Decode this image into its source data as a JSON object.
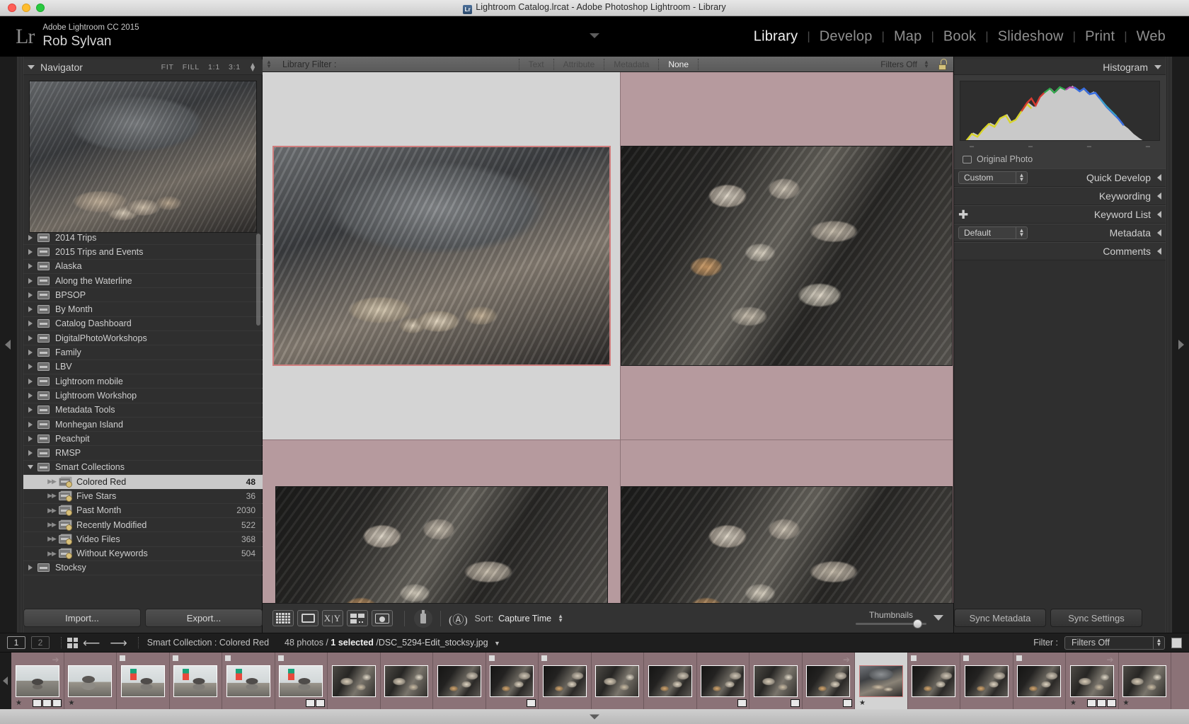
{
  "window": {
    "title": "Lightroom Catalog.lrcat - Adobe Photoshop Lightroom - Library",
    "app_icon": "lightroom-app-icon"
  },
  "identity": {
    "logo": "Lr",
    "product": "Adobe Lightroom CC 2015",
    "user": "Rob Sylvan"
  },
  "modules": [
    {
      "label": "Library",
      "active": true
    },
    {
      "label": "Develop",
      "active": false
    },
    {
      "label": "Map",
      "active": false
    },
    {
      "label": "Book",
      "active": false
    },
    {
      "label": "Slideshow",
      "active": false
    },
    {
      "label": "Print",
      "active": false
    },
    {
      "label": "Web",
      "active": false
    }
  ],
  "navigator": {
    "title": "Navigator",
    "zoom_levels": [
      "FIT",
      "FILL",
      "1:1",
      "3:1"
    ]
  },
  "collections": [
    {
      "label": "2014 Trips",
      "count": "",
      "level": 0,
      "twisty": "closed",
      "icon": "folder-icon"
    },
    {
      "label": "2015 Trips and Events",
      "count": "",
      "level": 0,
      "twisty": "closed",
      "icon": "folder-icon"
    },
    {
      "label": "Alaska",
      "count": "",
      "level": 0,
      "twisty": "closed",
      "icon": "folder-icon"
    },
    {
      "label": "Along the Waterline",
      "count": "",
      "level": 0,
      "twisty": "closed",
      "icon": "folder-icon"
    },
    {
      "label": "BPSOP",
      "count": "",
      "level": 0,
      "twisty": "closed",
      "icon": "folder-icon"
    },
    {
      "label": "By Month",
      "count": "",
      "level": 0,
      "twisty": "closed",
      "icon": "folder-icon"
    },
    {
      "label": "Catalog Dashboard",
      "count": "",
      "level": 0,
      "twisty": "closed",
      "icon": "folder-icon"
    },
    {
      "label": "DigitalPhotoWorkshops",
      "count": "",
      "level": 0,
      "twisty": "closed",
      "icon": "folder-icon"
    },
    {
      "label": "Family",
      "count": "",
      "level": 0,
      "twisty": "closed",
      "icon": "folder-icon"
    },
    {
      "label": "LBV",
      "count": "",
      "level": 0,
      "twisty": "closed",
      "icon": "folder-icon"
    },
    {
      "label": "Lightroom mobile",
      "count": "",
      "level": 0,
      "twisty": "closed",
      "icon": "folder-icon"
    },
    {
      "label": "Lightroom Workshop",
      "count": "",
      "level": 0,
      "twisty": "closed",
      "icon": "folder-icon"
    },
    {
      "label": "Metadata Tools",
      "count": "",
      "level": 0,
      "twisty": "closed",
      "icon": "folder-icon"
    },
    {
      "label": "Monhegan Island",
      "count": "",
      "level": 0,
      "twisty": "closed",
      "icon": "folder-icon"
    },
    {
      "label": "Peachpit",
      "count": "",
      "level": 0,
      "twisty": "closed",
      "icon": "folder-icon"
    },
    {
      "label": "RMSP",
      "count": "",
      "level": 0,
      "twisty": "closed",
      "icon": "folder-icon"
    },
    {
      "label": "Smart Collections",
      "count": "",
      "level": 0,
      "twisty": "open",
      "icon": "folder-icon"
    },
    {
      "label": "Colored Red",
      "count": "48",
      "level": 1,
      "twisty": "dots",
      "icon": "smart-collection-icon",
      "selected": true
    },
    {
      "label": "Five Stars",
      "count": "36",
      "level": 1,
      "twisty": "dots",
      "icon": "smart-collection-icon"
    },
    {
      "label": "Past Month",
      "count": "2030",
      "level": 1,
      "twisty": "dots",
      "icon": "smart-collection-icon"
    },
    {
      "label": "Recently Modified",
      "count": "522",
      "level": 1,
      "twisty": "dots",
      "icon": "smart-collection-icon"
    },
    {
      "label": "Video Files",
      "count": "368",
      "level": 1,
      "twisty": "dots",
      "icon": "smart-collection-icon"
    },
    {
      "label": "Without Keywords",
      "count": "504",
      "level": 1,
      "twisty": "dots",
      "icon": "smart-collection-icon"
    },
    {
      "label": "Stocksy",
      "count": "",
      "level": 0,
      "twisty": "closed",
      "icon": "folder-icon"
    }
  ],
  "left_buttons": {
    "import": "Import...",
    "export": "Export..."
  },
  "library_filter": {
    "label": "Library Filter :",
    "tabs": [
      {
        "label": "Text",
        "active": false
      },
      {
        "label": "Attribute",
        "active": false
      },
      {
        "label": "Metadata",
        "active": false
      },
      {
        "label": "None",
        "active": true
      }
    ],
    "filters_state": "Filters Off",
    "lock_icon": "unlocked-padlock-icon"
  },
  "grid": {
    "cells": [
      {
        "name": "grid-cell-1",
        "selected": true,
        "art": "rock-a",
        "photo": "DSC_5294-Edit_stocksy.jpg"
      },
      {
        "name": "grid-cell-2",
        "selected": false,
        "art": "rock-b",
        "photo": ""
      },
      {
        "name": "grid-cell-3",
        "selected": false,
        "art": "rock-b",
        "photo": ""
      },
      {
        "name": "grid-cell-4",
        "selected": false,
        "art": "rock-b",
        "photo": ""
      }
    ]
  },
  "toolbar": {
    "view_buttons": [
      {
        "name": "grid-view-button",
        "icon": "grid-view-icon"
      },
      {
        "name": "loupe-view-button",
        "icon": "loupe-view-icon"
      },
      {
        "name": "compare-view-button",
        "icon": "compare-view-icon"
      },
      {
        "name": "survey-view-button",
        "icon": "survey-view-icon"
      },
      {
        "name": "people-view-button",
        "icon": "people-view-icon"
      }
    ],
    "painter": "spray-can-icon",
    "sort_icon": "az-sort-icon",
    "sort_label": "Sort:",
    "sort_value": "Capture Time",
    "thumbnails_label": "Thumbnails"
  },
  "right_panel": {
    "histogram": {
      "title": "Histogram",
      "ticks": [
        "–",
        "–",
        "–",
        "–"
      ],
      "original_photo_label": "Original Photo"
    },
    "rows": [
      {
        "title": "Quick Develop",
        "select": "Custom",
        "has_select": true,
        "has_plus": false,
        "name": "quick-develop-panel"
      },
      {
        "title": "Keywording",
        "select": "",
        "has_select": false,
        "has_plus": false,
        "name": "keywording-panel"
      },
      {
        "title": "Keyword List",
        "select": "",
        "has_select": false,
        "has_plus": true,
        "name": "keyword-list-panel"
      },
      {
        "title": "Metadata",
        "select": "Default",
        "has_select": true,
        "has_plus": false,
        "name": "metadata-panel"
      },
      {
        "title": "Comments",
        "select": "",
        "has_select": false,
        "has_plus": false,
        "name": "comments-panel"
      }
    ],
    "sync_metadata": "Sync Metadata",
    "sync_settings": "Sync Settings"
  },
  "filmstrip_bar": {
    "page_buttons": [
      "1",
      "2"
    ],
    "grid_icon": "grid-toggle-icon",
    "back_arrow": "back-arrow-icon",
    "forward_arrow": "forward-arrow-icon",
    "source": "Smart Collection : Colored Red",
    "count": "48 photos /",
    "selected": "1 selected",
    "filename": "/DSC_5294-Edit_stocksy.jpg",
    "filter_label": "Filter :",
    "filter_value": "Filters Off"
  },
  "filmstrip": {
    "thumbs": [
      {
        "art": "zen1",
        "badge": false,
        "flag": true,
        "star": true,
        "icons": [
          "stack",
          "crop",
          "develop"
        ],
        "selected": false
      },
      {
        "art": "zen2",
        "badge": false,
        "flag": false,
        "star": true,
        "icons": [],
        "selected": false
      },
      {
        "art": "zen3",
        "badge": true,
        "flag": false,
        "star": false,
        "icons": [],
        "selected": false
      },
      {
        "art": "zen3",
        "badge": true,
        "flag": false,
        "star": false,
        "icons": [],
        "selected": false
      },
      {
        "art": "zen3",
        "badge": true,
        "flag": false,
        "star": false,
        "icons": [],
        "selected": false
      },
      {
        "art": "zen3",
        "badge": true,
        "flag": false,
        "star": false,
        "icons": [
          "crop",
          "develop"
        ],
        "selected": false
      },
      {
        "art": "rk2",
        "badge": false,
        "flag": false,
        "star": false,
        "icons": [],
        "selected": false
      },
      {
        "art": "rk2",
        "badge": false,
        "flag": false,
        "star": false,
        "icons": [],
        "selected": false
      },
      {
        "art": "rk1",
        "badge": false,
        "flag": false,
        "star": false,
        "icons": [],
        "selected": false
      },
      {
        "art": "rk1",
        "badge": true,
        "flag": false,
        "star": false,
        "icons": [
          "develop"
        ],
        "selected": false
      },
      {
        "art": "rk1",
        "badge": true,
        "flag": false,
        "star": false,
        "icons": [],
        "selected": false
      },
      {
        "art": "rk2",
        "badge": false,
        "flag": false,
        "star": false,
        "icons": [],
        "selected": false
      },
      {
        "art": "rk1",
        "badge": false,
        "flag": false,
        "star": false,
        "icons": [],
        "selected": false
      },
      {
        "art": "rk1",
        "badge": false,
        "flag": false,
        "star": false,
        "icons": [
          "develop"
        ],
        "selected": false
      },
      {
        "art": "rk2",
        "badge": false,
        "flag": false,
        "star": false,
        "icons": [
          "develop"
        ],
        "selected": false
      },
      {
        "art": "rk1",
        "badge": false,
        "flag": true,
        "star": false,
        "icons": [
          "stack"
        ],
        "selected": false
      },
      {
        "art": "rk-sel",
        "badge": false,
        "flag": false,
        "star": true,
        "icons": [],
        "selected": true
      },
      {
        "art": "rk1",
        "badge": true,
        "flag": false,
        "star": false,
        "icons": [],
        "selected": false
      },
      {
        "art": "rk1",
        "badge": true,
        "flag": false,
        "star": false,
        "icons": [],
        "selected": false
      },
      {
        "art": "rk1",
        "badge": true,
        "flag": false,
        "star": false,
        "icons": [],
        "selected": false
      },
      {
        "art": "rk2",
        "badge": false,
        "flag": true,
        "star": true,
        "icons": [
          "stack",
          "crop",
          "develop"
        ],
        "selected": false
      },
      {
        "art": "rk2",
        "badge": false,
        "flag": false,
        "star": true,
        "icons": [],
        "selected": false
      }
    ]
  },
  "colors": {
    "grid_background": "#b69a9e",
    "selected_cell": "#d4d4d4",
    "selection_border": "#cf7d7d",
    "panel_background": "#2f2f2f",
    "toolbar_background": "#333333",
    "accent_text": "#f2f2f2"
  }
}
